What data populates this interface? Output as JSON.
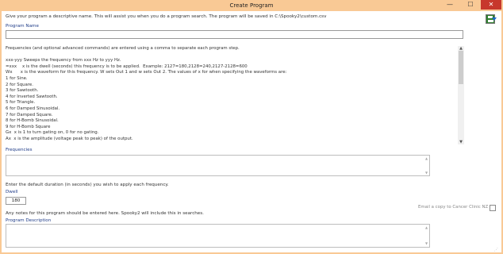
{
  "window": {
    "title": "Create Program",
    "minimize_glyph": "—",
    "maximize_glyph": "☐",
    "close_glyph": "✕"
  },
  "intro": "Give your program a descriptive name. This will assist you when you do a program search. The program will be saved in C:\\Spooky2\\custom.csv",
  "program_name": {
    "label": "Program Name",
    "value": ""
  },
  "help_lines": [
    "Frequencies (and optional advanced commands) are entered using a comma to separate each program step.",
    "",
    "xxx-yyy Sweeps the frequency from xxx Hz to yyy Hz.",
    "=xxx    x is the dwell (seconds) this frequency is to be applied.  Example: 2127=180,2128=240,2127-2128=600",
    "Wx      x is the waveform for this frequency. W sets Out 1 and w sets Out 2. The values of x for when specifying the waveforms are:",
    "1 for Sine.",
    "2 for Square.",
    "3 for Sawtooth.",
    "4 for Inverted Sawtooth.",
    "5 for Triangle.",
    "6 for Damped Sinusoidal.",
    "7 for Damped Square.",
    "8 for H-Bomb Sinusoidal.",
    "9 for H-Bomb Square",
    "Gx  x is 1 to turn gating on, 0 for no gating.",
    "Ax  x is the amplitude (voltage peak to peak) of the output."
  ],
  "frequencies": {
    "label": "Frequencies",
    "value": ""
  },
  "dwell_intro": "Enter the default duration (in seconds) you wish to apply each frequency.",
  "dwell": {
    "label": "Dwell",
    "value": "180"
  },
  "email_label": "Email a copy to Cancer Clinic NZ",
  "notes_intro": "Any notes for this program should be entered here. Spooky2 will include this in searches.",
  "program_description": {
    "label": "Program Description",
    "value": ""
  },
  "icons": {
    "save": "save-disk-icon"
  },
  "colors": {
    "title_bar": "#f9c995",
    "label_blue": "#1f3c88",
    "close_button": "#c7372c"
  }
}
